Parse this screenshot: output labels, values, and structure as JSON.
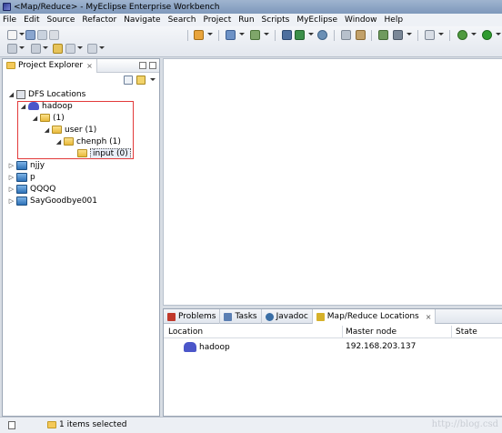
{
  "window": {
    "title": "<Map/Reduce> - MyEclipse Enterprise Workbench"
  },
  "menu": [
    "File",
    "Edit",
    "Source",
    "Refactor",
    "Navigate",
    "Search",
    "Project",
    "Run",
    "Scripts",
    "MyEclipse",
    "Window",
    "Help"
  ],
  "explorer": {
    "title": "Project Explorer",
    "close_glyph": "×",
    "tree": [
      {
        "label": "DFS Locations",
        "icon": "dfs-icon",
        "twisty": "◢",
        "depth": 0
      },
      {
        "label": "hadoop",
        "icon": "elephant-icon",
        "twisty": "◢",
        "depth": 1
      },
      {
        "label": "(1)",
        "icon": "folder-open-icon",
        "twisty": "◢",
        "depth": 2
      },
      {
        "label": "user (1)",
        "icon": "folder-open-icon",
        "twisty": "◢",
        "depth": 3
      },
      {
        "label": "chenph (1)",
        "icon": "folder-open-icon",
        "twisty": "◢",
        "depth": 4
      },
      {
        "label": "input (0)",
        "icon": "folder-open-icon",
        "twisty": "",
        "depth": 5,
        "selected": true
      },
      {
        "label": "njjy",
        "icon": "project-icon",
        "twisty": "▷",
        "depth": 0
      },
      {
        "label": "p",
        "icon": "project-icon",
        "twisty": "▷",
        "depth": 0
      },
      {
        "label": "QQQQ",
        "icon": "project-icon",
        "twisty": "▷",
        "depth": 0
      },
      {
        "label": "SayGoodbye001",
        "icon": "project-icon",
        "twisty": "▷",
        "depth": 0
      }
    ]
  },
  "bottom_panel": {
    "tabs": [
      {
        "label": "Problems",
        "icon": "problems-icon",
        "color": "#c0392b"
      },
      {
        "label": "Tasks",
        "icon": "tasks-icon",
        "color": "#5b7fb3"
      },
      {
        "label": "Javadoc",
        "icon": "javadoc-icon",
        "color": "#3a6ea5"
      },
      {
        "label": "Map/Reduce Locations",
        "icon": "mapreduce-icon",
        "color": "#d6b12a",
        "active": true,
        "close_glyph": "×"
      }
    ],
    "columns": [
      "Location",
      "Master node",
      "State"
    ],
    "rows": [
      {
        "location": "hadoop",
        "master_node": "192.168.203.137",
        "state": ""
      }
    ]
  },
  "status": {
    "text": "1 items selected"
  },
  "watermark": "http://blog.csd"
}
